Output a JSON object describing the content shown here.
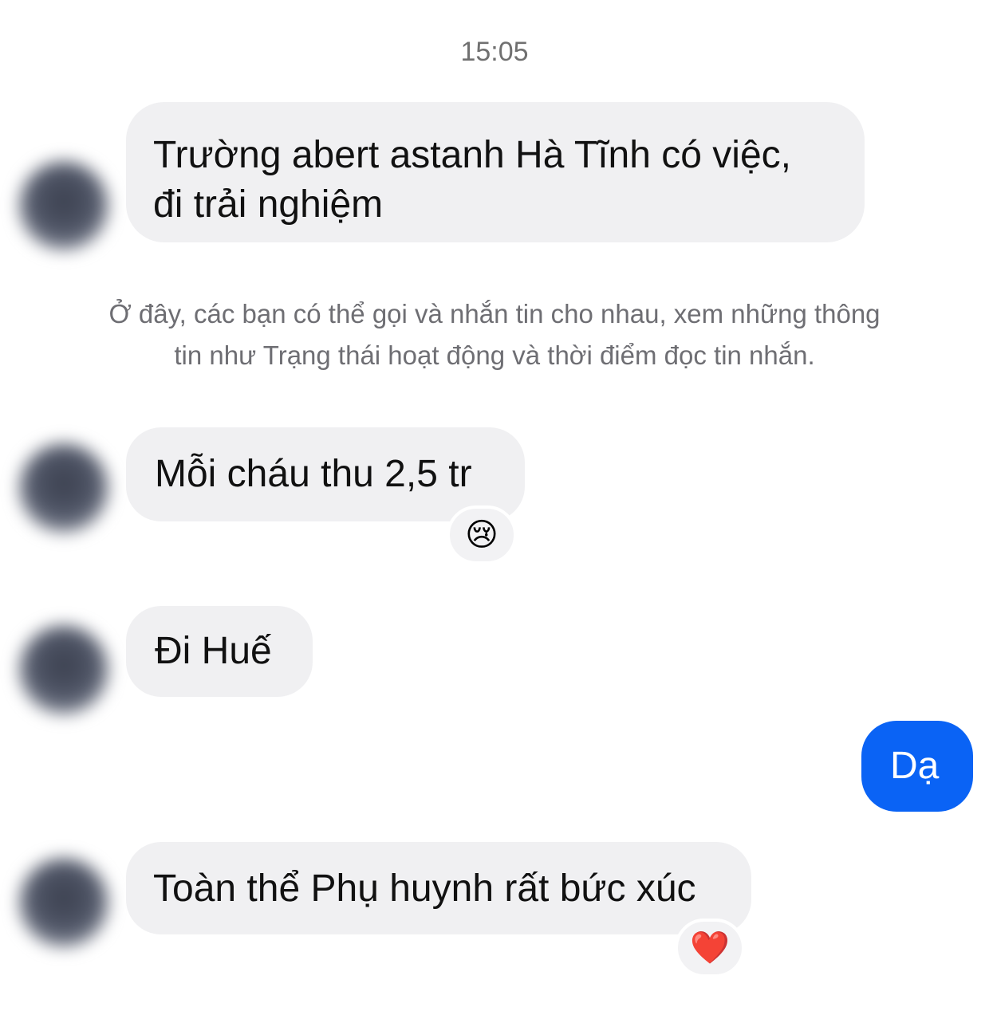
{
  "chat": {
    "timestamp": "15:05",
    "messages": [
      {
        "direction": "incoming",
        "lines": [
          "Trường abert astanh Hà Tĩnh có việc,",
          "đi trải nghiệm"
        ]
      },
      {
        "direction": "incoming",
        "text": "Mỗi cháu thu 2,5 tr",
        "reaction": "😢"
      },
      {
        "direction": "incoming",
        "text": "Đi Huế"
      },
      {
        "direction": "outgoing",
        "text": "Dạ"
      },
      {
        "direction": "incoming",
        "text": "Toàn thể Phụ huynh rất bức xúc",
        "reaction": "❤️"
      }
    ],
    "system_note": {
      "lines": [
        "Ở đây, các bạn có thể gọi và nhắn tin cho nhau, xem những thông",
        "tin như Trạng thái hoạt động và thời điểm đọc tin nhắn."
      ]
    }
  },
  "colors": {
    "incoming_bubble": "#f0f0f2",
    "outgoing_bubble": "#0a63f5",
    "meta_text": "#6e6e73"
  }
}
